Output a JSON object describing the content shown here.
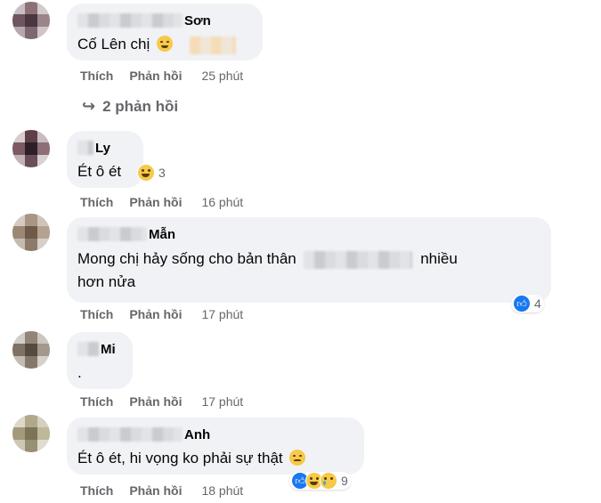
{
  "comments": [
    {
      "author": "Sơn",
      "text": "Cố Lên chị",
      "actions": {
        "like": "Thích",
        "reply": "Phản hồi",
        "time": "25 phút"
      },
      "replies_link": "2 phản hồi"
    },
    {
      "author": "Ly",
      "text": "Ét ô ét",
      "reaction_count": "3",
      "actions": {
        "like": "Thích",
        "reply": "Phản hồi",
        "time": "16 phút"
      }
    },
    {
      "author": "Mẫn",
      "text_before": "Mong chị hảy sống cho bản thân",
      "text_after": "nhiều",
      "text_line2": "hơn nửa",
      "reaction_count": "4",
      "actions": {
        "like": "Thích",
        "reply": "Phản hồi",
        "time": "17 phút"
      }
    },
    {
      "author": "Mi",
      "text": ".",
      "actions": {
        "like": "Thích",
        "reply": "Phản hồi",
        "time": "17 phút"
      }
    },
    {
      "author": "Anh",
      "text": "Ét ô ét, hi vọng ko phải sự thật",
      "reaction_count": "9",
      "actions": {
        "like": "Thích",
        "reply": "Phản hồi",
        "time": "18 phút"
      }
    }
  ],
  "colors": {
    "bubble": "#f0f2f5",
    "meta": "#65676b",
    "like_blue": "#1877f2",
    "emoji_yellow": "#f7c948"
  },
  "icons": [
    "reply-arrow-icon",
    "like-reaction-icon",
    "haha-reaction-icon",
    "sad-reaction-icon"
  ]
}
